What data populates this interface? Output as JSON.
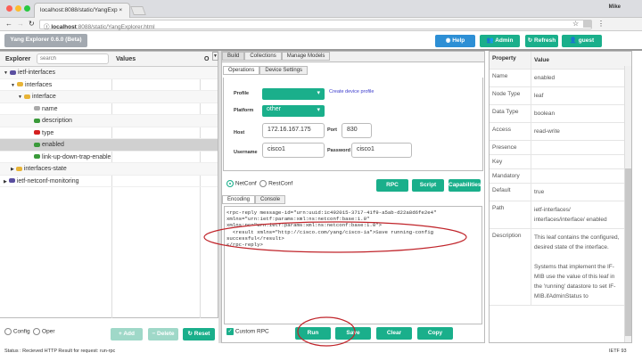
{
  "browser": {
    "tab_title": "localhost:8088/static/YangExp",
    "url_host": "localhost",
    "url_rest": ":8088/static/YangExplorer.html",
    "user": "Mike"
  },
  "header": {
    "app_title": "Yang Explorer 0.6.0 (Beta)",
    "help": "Help",
    "admin": "Admin",
    "refresh": "Refresh",
    "guest": "guest"
  },
  "explorer": {
    "col_explorer": "Explorer",
    "search_placeholder": "search",
    "col_values": "Values",
    "col_op": "O",
    "tree": [
      {
        "label": "ietf-interfaces",
        "icon": "module-icon",
        "depth": 0,
        "arrow": "▼"
      },
      {
        "label": "interfaces",
        "icon": "folder-icon",
        "depth": 1,
        "arrow": "▼"
      },
      {
        "label": "interface",
        "icon": "list-folder-icon",
        "depth": 2,
        "arrow": "▼"
      },
      {
        "label": "name",
        "icon": "key-icon",
        "depth": 3,
        "arrow": ""
      },
      {
        "label": "description",
        "icon": "leaf-icon",
        "depth": 3,
        "arrow": ""
      },
      {
        "label": "type",
        "icon": "leaf-mandatory-icon",
        "depth": 3,
        "arrow": ""
      },
      {
        "label": "enabled",
        "icon": "leaf-icon",
        "depth": 3,
        "arrow": "",
        "selected": true
      },
      {
        "label": "link-up-down-trap-enable",
        "icon": "leaf-icon",
        "depth": 3,
        "arrow": ""
      },
      {
        "label": "interfaces-state",
        "icon": "folder-icon",
        "depth": 1,
        "arrow": "▶"
      },
      {
        "label": "ietf-netconf-monitoring",
        "icon": "module-icon",
        "depth": 0,
        "arrow": "▶"
      }
    ],
    "config": "Config",
    "oper": "Oper",
    "add": "+ Add",
    "delete": "− Delete",
    "reset": "Reset"
  },
  "center": {
    "tabs": [
      "Build",
      "Collections",
      "Manage Models"
    ],
    "subtabs": [
      "Operations",
      "Device Settings"
    ],
    "profile_label": "Profile",
    "create_profile": "Create device profile",
    "platform_label": "Platform",
    "platform_value": "other",
    "host_label": "Host",
    "host_value": "172.16.167.175",
    "port_label": "Port",
    "port_value": "830",
    "username_label": "Username",
    "username_value": "cisco1",
    "password_label": "Password",
    "password_value": "cisco1",
    "netconf": "NetConf",
    "restconf": "RestConf",
    "rpc": "RPC",
    "script": "Script",
    "capabilities": "Capabilities",
    "enc_tabs": [
      "Encoding",
      "Console"
    ],
    "output": "<rpc-reply message-id=\"urn:uuid:1c492015-3717-41f9-a5ab-d22a8d6fe2e4\"\nxmlns=\"urn:ietf:params:xml:ns:netconf:base:1.0\"\nxmlns:nc=\"urn:ietf:params:xml:ns:netconf:base:1.0\">\n  <result xmlns=\"http://cisco.com/yang/cisco-ia\">Save running-config\nsuccessful</result>\n</rpc-reply>",
    "custom_rpc": "Custom RPC",
    "run": "Run",
    "save": "Save",
    "clear": "Clear",
    "copy": "Copy"
  },
  "properties": {
    "col_property": "Property",
    "col_value": "Value",
    "rows": [
      {
        "k": "Name",
        "v": "enabled"
      },
      {
        "k": "Node Type",
        "v": "leaf"
      },
      {
        "k": "Data Type",
        "v": "boolean"
      },
      {
        "k": "Access",
        "v": "read-write"
      },
      {
        "k": "Presence",
        "v": ""
      },
      {
        "k": "Key",
        "v": ""
      },
      {
        "k": "Mandatory",
        "v": ""
      },
      {
        "k": "Default",
        "v": "true"
      },
      {
        "k": "Path",
        "v": "ietf-interfaces/ interfaces/interface/ enabled"
      },
      {
        "k": "Description",
        "v": "This leaf contains the configured, desired state of the interface.\n\nSystems that implement the IF-MIB use the value of this leaf in the 'running' datastore to set IF-MIB.ifAdminStatus to"
      }
    ]
  },
  "status": {
    "text": "Status : Recieved HTTP Result for request: run-rpc",
    "version": "IETF 93"
  },
  "colors": {
    "accent": "#1aaf8b",
    "help": "#2d8fd5",
    "annotation": "#c0242a"
  }
}
